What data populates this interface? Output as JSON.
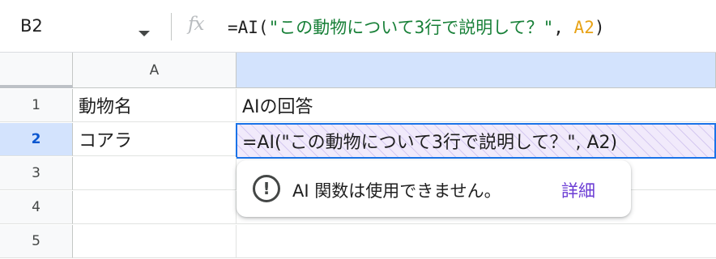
{
  "formula_bar": {
    "name_box": "B2",
    "fx_label": "fx",
    "formula": {
      "prefix": "=AI(",
      "string_arg": "\"この動物について3行で説明して？\"",
      "separator": ", ",
      "ref_arg": "A2",
      "suffix": ")"
    }
  },
  "grid": {
    "columns": [
      "A",
      ""
    ],
    "rows": [
      {
        "num": "1",
        "a": "動物名",
        "b": "AIの回答"
      },
      {
        "num": "2",
        "a": "コアラ",
        "b": "=AI(\"この動物について3行で説明して？\", A2)"
      },
      {
        "num": "3",
        "a": "",
        "b": ""
      },
      {
        "num": "4",
        "a": "",
        "b": ""
      },
      {
        "num": "5",
        "a": "",
        "b": ""
      }
    ],
    "active_row": "2"
  },
  "tooltip": {
    "message": "AI 関数は使用できません。",
    "link": "詳細"
  },
  "colors": {
    "selection": "#d3e3fd",
    "active_border": "#1a73e8",
    "string_token": "#188038",
    "ref_token": "#e8a317",
    "link": "#6b3cd4"
  }
}
